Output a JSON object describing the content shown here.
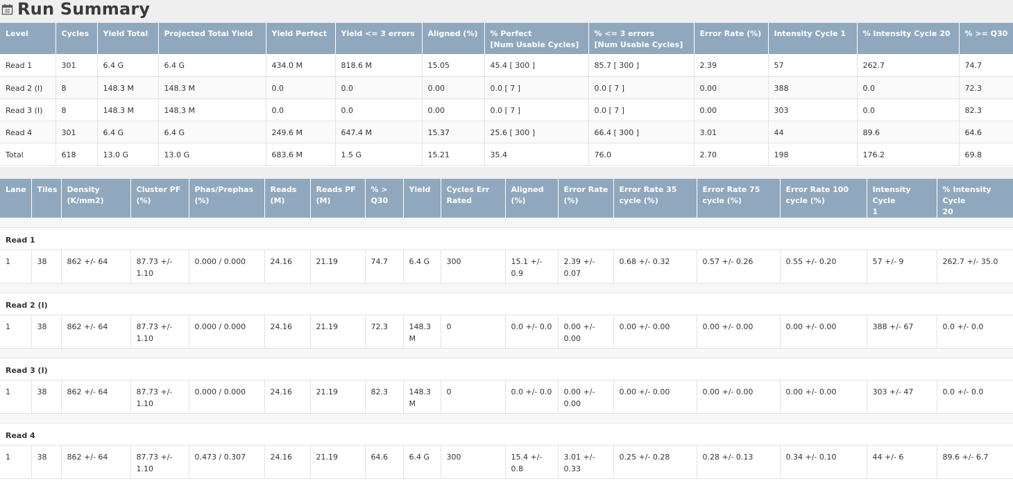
{
  "page": {
    "title": "Run Summary",
    "icon": "calendar-icon"
  },
  "run_table": {
    "headers": [
      "Level",
      "Cycles",
      "Yield Total",
      "Projected Total Yield",
      "Yield Perfect",
      "Yield <= 3 errors",
      "Aligned (%)",
      "% Perfect\n[Num Usable Cycles]",
      "% <= 3 errors\n[Num Usable Cycles]",
      "Error Rate (%)",
      "Intensity Cycle 1",
      "% Intensity Cycle 20",
      "% >= Q30"
    ],
    "rows": [
      [
        "Read 1",
        "301",
        "6.4 G",
        "6.4 G",
        "434.0 M",
        "818.6 M",
        "15.05",
        "45.4 [ 300 ]",
        "85.7 [ 300 ]",
        "2.39",
        "57",
        "262.7",
        "74.7"
      ],
      [
        "Read 2 (I)",
        "8",
        "148.3 M",
        "148.3 M",
        "0.0",
        "0.0",
        "0.00",
        "0.0 [ 7 ]",
        "0.0 [ 7 ]",
        "0.00",
        "388",
        "0.0",
        "72.3"
      ],
      [
        "Read 3 (I)",
        "8",
        "148.3 M",
        "148.3 M",
        "0.0",
        "0.0",
        "0.00",
        "0.0 [ 7 ]",
        "0.0 [ 7 ]",
        "0.00",
        "303",
        "0.0",
        "82.3"
      ],
      [
        "Read 4",
        "301",
        "6.4 G",
        "6.4 G",
        "249.6 M",
        "647.4 M",
        "15.37",
        "25.6 [ 300 ]",
        "66.4 [ 300 ]",
        "3.01",
        "44",
        "89.6",
        "64.6"
      ],
      [
        "Total",
        "618",
        "13.0 G",
        "13.0 G",
        "683.6 M",
        "1.5 G",
        "15.21",
        "35.4",
        "76.0",
        "2.70",
        "198",
        "176.2",
        "69.8"
      ]
    ]
  },
  "lane_table": {
    "headers": [
      "Lane",
      "Tiles",
      "Density\n(K/mm2)",
      "Cluster PF\n(%)",
      "Phas/Prephas\n(%)",
      "Reads\n(M)",
      "Reads PF\n(M)",
      "% >\nQ30",
      "Yield",
      "Cycles Err\nRated",
      "Aligned\n(%)",
      "Error Rate\n(%)",
      "Error Rate 35\ncycle (%)",
      "Error Rate 75\ncycle (%)",
      "Error Rate 100\ncycle (%)",
      "Intensity Cycle\n1",
      "% Intensity Cycle\n20"
    ],
    "groups": [
      {
        "name": "Read 1",
        "rows": [
          [
            "1",
            "38",
            "862 +/- 64",
            "87.73 +/-\n1.10",
            "0.000 / 0.000",
            "24.16",
            "21.19",
            "74.7",
            "6.4 G",
            "300",
            "15.1 +/-\n0.9",
            "2.39 +/-\n0.07",
            "0.68 +/- 0.32",
            "0.57 +/- 0.26",
            "0.55 +/- 0.20",
            "57 +/- 9",
            "262.7 +/- 35.0"
          ]
        ]
      },
      {
        "name": "Read 2 (I)",
        "rows": [
          [
            "1",
            "38",
            "862 +/- 64",
            "87.73 +/-\n1.10",
            "0.000 / 0.000",
            "24.16",
            "21.19",
            "72.3",
            "148.3\nM",
            "0",
            "0.0 +/- 0.0",
            "0.00 +/-\n0.00",
            "0.00 +/- 0.00",
            "0.00 +/- 0.00",
            "0.00 +/- 0.00",
            "388 +/- 67",
            "0.0 +/- 0.0"
          ]
        ]
      },
      {
        "name": "Read 3 (I)",
        "rows": [
          [
            "1",
            "38",
            "862 +/- 64",
            "87.73 +/-\n1.10",
            "0.000 / 0.000",
            "24.16",
            "21.19",
            "82.3",
            "148.3\nM",
            "0",
            "0.0 +/- 0.0",
            "0.00 +/-\n0.00",
            "0.00 +/- 0.00",
            "0.00 +/- 0.00",
            "0.00 +/- 0.00",
            "303 +/- 47",
            "0.0 +/- 0.0"
          ]
        ]
      },
      {
        "name": "Read 4",
        "rows": [
          [
            "1",
            "38",
            "862 +/- 64",
            "87.73 +/-\n1.10",
            "0.473 / 0.307",
            "24.16",
            "21.19",
            "64.6",
            "6.4 G",
            "300",
            "15.4 +/-\n0.8",
            "3.01 +/-\n0.33",
            "0.25 +/- 0.28",
            "0.28 +/- 0.13",
            "0.34 +/- 0.10",
            "44 +/- 6",
            "89.6 +/- 6.7"
          ]
        ]
      }
    ]
  }
}
